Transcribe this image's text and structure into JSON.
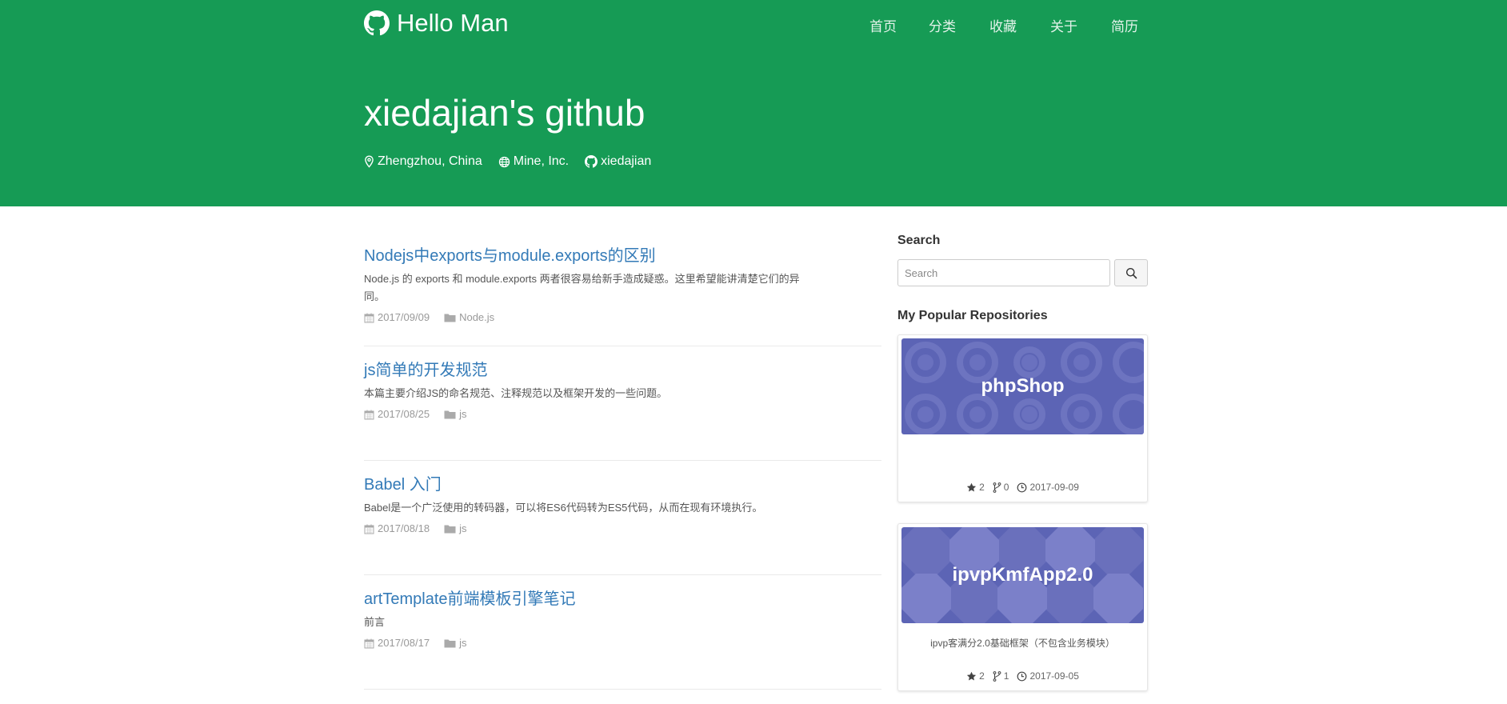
{
  "header": {
    "brand": "Hello Man",
    "nav": [
      "首页",
      "分类",
      "收藏",
      "关于",
      "简历"
    ]
  },
  "hero": {
    "title": "xiedajian's github",
    "location": "Zhengzhou, China",
    "company": "Mine, Inc.",
    "github": "xiedajian"
  },
  "posts": [
    {
      "title": "Nodejs中exports与module.exports的区别",
      "excerpt": "Node.js 的 exports 和 module.exports 两者很容易给新手造成疑惑。这里希望能讲清楚它们的异同。",
      "date": "2017/09/09",
      "category": "Node.js"
    },
    {
      "title": "js简单的开发规范",
      "excerpt": "本篇主要介绍JS的命名规范、注释规范以及框架开发的一些问题。",
      "date": "2017/08/25",
      "category": "js"
    },
    {
      "title": "Babel 入门",
      "excerpt": "Babel是一个广泛使用的转码器，可以将ES6代码转为ES5代码，从而在现有环境执行。",
      "date": "2017/08/18",
      "category": "js"
    },
    {
      "title": "artTemplate前端模板引擎笔记",
      "excerpt": "前言",
      "date": "2017/08/17",
      "category": "js"
    }
  ],
  "sidebar": {
    "search_heading": "Search",
    "search_placeholder": "Search",
    "repos_heading": "My Popular Repositories",
    "repos": [
      {
        "name": "phpShop",
        "description": "",
        "stars": "2",
        "forks": "0",
        "updated": "2017-09-09"
      },
      {
        "name": "ipvpKmfApp2.0",
        "description": "ipvp客满分2.0基础框架（不包含业务模块）",
        "stars": "2",
        "forks": "1",
        "updated": "2017-09-05"
      }
    ]
  },
  "colors": {
    "hero_bg": "#169b55",
    "link": "#337ab7",
    "repo_banner": "#5c64b5"
  }
}
